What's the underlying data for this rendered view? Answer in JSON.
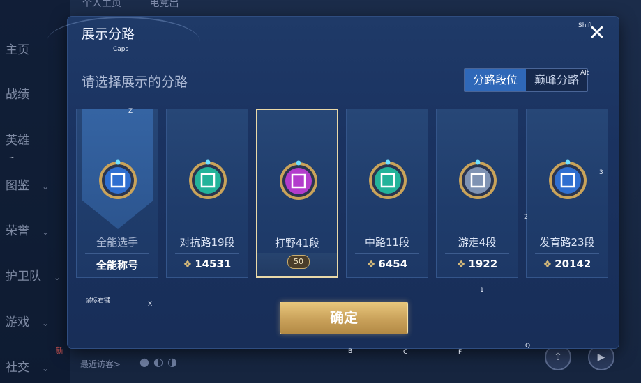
{
  "background": {
    "top_tabs": [
      "个人主页",
      "电竞出"
    ],
    "nav": [
      {
        "label": "主页",
        "has_arrow": false
      },
      {
        "label": "战绩",
        "has_arrow": false
      },
      {
        "label": "英雄",
        "has_arrow": false
      },
      {
        "label": "图鉴",
        "has_arrow": true
      },
      {
        "label": "荣誉",
        "has_arrow": true
      },
      {
        "label": "护卫队",
        "has_arrow": true
      },
      {
        "label": "游戏",
        "has_arrow": true
      },
      {
        "label": "社交",
        "has_arrow": true
      }
    ],
    "new_badge": "新",
    "recent_visitors_label": "最近访客>",
    "arrow_glyph": "⌄"
  },
  "modal": {
    "title": "展示分路",
    "close_glyph": "✕",
    "subtitle": "请选择展示的分路",
    "segments": [
      {
        "label": "分路段位",
        "active": true
      },
      {
        "label": "巅峰分路",
        "active": false
      }
    ],
    "cards": [
      {
        "name": "全能选手",
        "score": "全能称号",
        "emblem": "allround-emblem-icon",
        "color": "#2f6fd0",
        "selected": false,
        "banner": true,
        "show_score_icon": false
      },
      {
        "name": "对抗路19段",
        "score": "14531",
        "emblem": "clash-lane-emblem-icon",
        "color": "#23b39a",
        "selected": false,
        "banner": false,
        "show_score_icon": true
      },
      {
        "name": "打野41段",
        "score": "50",
        "emblem": "jungle-emblem-icon",
        "color": "#b33ccc",
        "selected": true,
        "banner": false,
        "show_score_icon": false
      },
      {
        "name": "中路11段",
        "score": "6454",
        "emblem": "mid-lane-emblem-icon",
        "color": "#23b39a",
        "selected": false,
        "banner": false,
        "show_score_icon": true
      },
      {
        "name": "游走4段",
        "score": "1922",
        "emblem": "roam-emblem-icon",
        "color": "#7f93b3",
        "selected": false,
        "banner": false,
        "show_score_icon": true
      },
      {
        "name": "发育路23段",
        "score": "20142",
        "emblem": "farm-lane-emblem-icon",
        "color": "#2f6fd0",
        "selected": false,
        "banner": false,
        "show_score_icon": true
      }
    ],
    "confirm_label": "确定"
  },
  "key_hints": [
    "Shift",
    "Caps",
    "Alt",
    "Z",
    "~",
    "3",
    "2",
    "1",
    "鼠标右键",
    "X",
    "B",
    "C",
    "F",
    "Q"
  ],
  "colors": {
    "accent_gold": "#d5b979",
    "accent_blue": "#2f68b8"
  }
}
